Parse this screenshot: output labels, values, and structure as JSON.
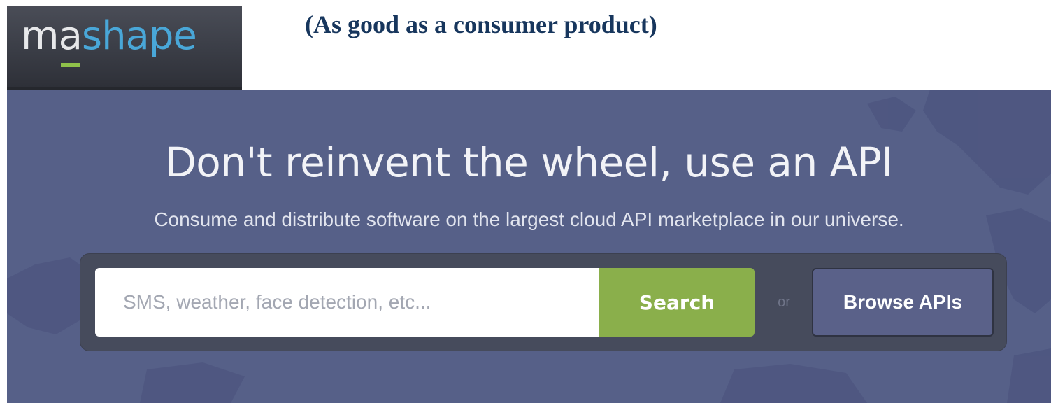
{
  "logo": {
    "part1": "m",
    "part2": "a",
    "part3": "shape"
  },
  "slide": {
    "caption": "(As good as a consumer product)"
  },
  "hero": {
    "headline": "Don't reinvent the wheel, use an API",
    "subline": "Consume and distribute software on the largest cloud API marketplace in our universe."
  },
  "search": {
    "placeholder": "SMS, weather, face detection, etc...",
    "button_label": "Search",
    "or_label": "or",
    "browse_label": "Browse APIs"
  },
  "colors": {
    "hero_background": "#566088",
    "search_button": "#8aaf4b",
    "browse_button": "#5a6189",
    "logo_accent": "#8fc14a",
    "logo_blue": "#49a7d8",
    "caption": "#17365d"
  }
}
